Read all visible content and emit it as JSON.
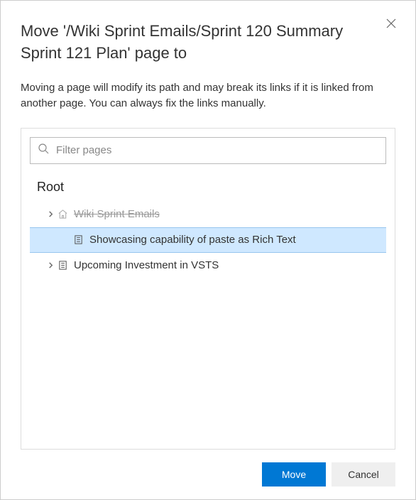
{
  "dialog": {
    "title": "Move '/Wiki Sprint Emails/Sprint 120 Summary Sprint 121 Plan' page to",
    "description": "Moving a page will modify its path and may break its links if it is linked from another page. You can always fix the links manually."
  },
  "filter": {
    "placeholder": "Filter pages"
  },
  "tree": {
    "root_label": "Root",
    "items": [
      {
        "label": "Wiki Sprint Emails",
        "icon": "home",
        "expandable": true,
        "disabled": true,
        "selected": false,
        "indent": 1
      },
      {
        "label": "Showcasing capability of paste as Rich Text",
        "icon": "page",
        "expandable": false,
        "disabled": false,
        "selected": true,
        "indent": 2
      },
      {
        "label": "Upcoming Investment in VSTS",
        "icon": "page",
        "expandable": true,
        "disabled": false,
        "selected": false,
        "indent": 1
      }
    ]
  },
  "actions": {
    "primary": "Move",
    "secondary": "Cancel"
  }
}
